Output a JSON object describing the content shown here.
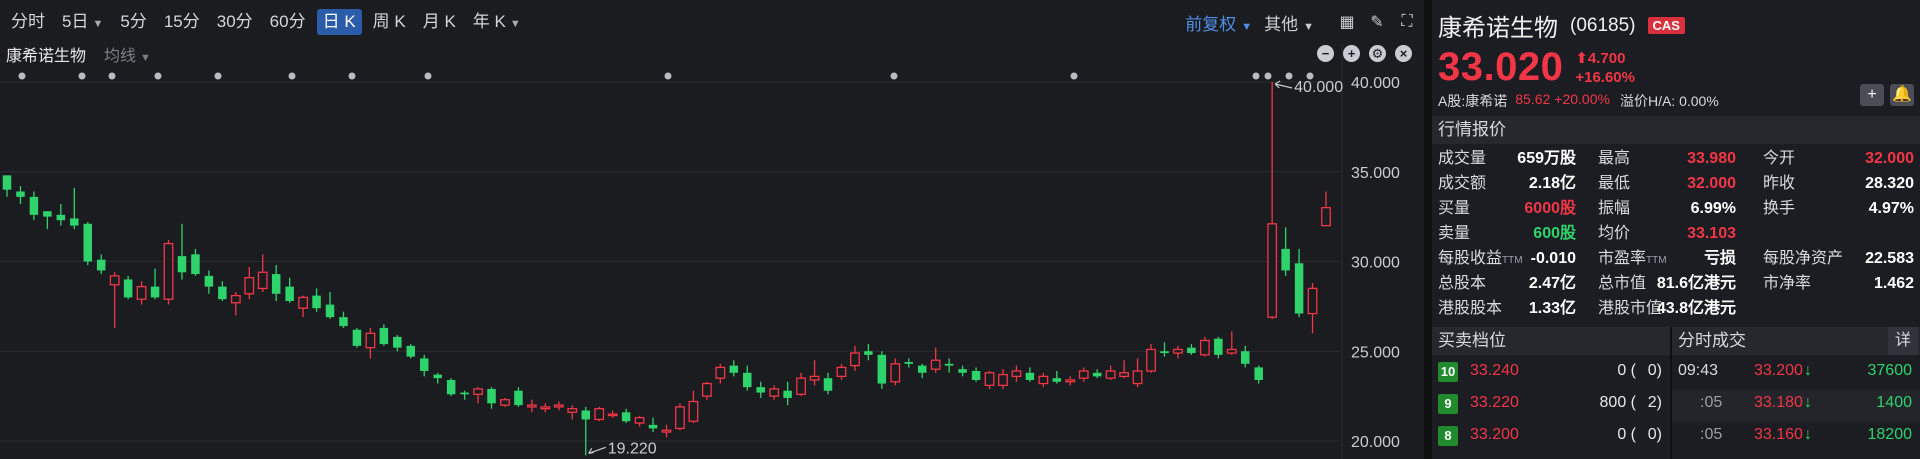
{
  "toolbar": {
    "periods": [
      "分时",
      "5日",
      "5分",
      "15分",
      "30分",
      "60分",
      "日 K",
      "周 K",
      "月 K",
      "年 K"
    ],
    "period_chevron": [
      "5日",
      "年 K"
    ],
    "active_period": "日 K",
    "restore_label": "前复权",
    "other_label": "其他"
  },
  "legend": {
    "name": "康希诺生物",
    "ma": "均线"
  },
  "chart_data": {
    "type": "candlestick",
    "yticks": [
      "40.000",
      "35.000",
      "30.000",
      "25.000",
      "20.000"
    ],
    "ytick_values": [
      40,
      35,
      30,
      25,
      20
    ],
    "annotation_high": "40.000",
    "annotation_low": "19.220",
    "colors": {
      "up": "#f23645",
      "down": "#2fd36b"
    },
    "candles": [
      [
        34.8,
        34.8,
        33.6,
        34.0
      ],
      [
        33.9,
        34.2,
        33.2,
        33.6
      ],
      [
        33.6,
        33.9,
        32.3,
        32.6
      ],
      [
        32.8,
        32.8,
        31.8,
        32.5
      ],
      [
        32.6,
        33.2,
        32.0,
        32.3
      ],
      [
        32.4,
        34.1,
        31.8,
        32.0
      ],
      [
        32.1,
        32.2,
        29.8,
        30.0
      ],
      [
        30.1,
        30.4,
        29.3,
        29.5
      ],
      [
        28.7,
        29.4,
        26.3,
        29.2
      ],
      [
        29.0,
        29.2,
        27.9,
        28.0
      ],
      [
        27.9,
        28.9,
        27.6,
        28.6
      ],
      [
        28.6,
        29.6,
        27.9,
        28.0
      ],
      [
        27.9,
        31.2,
        27.6,
        31.0
      ],
      [
        30.3,
        32.1,
        29.0,
        29.4
      ],
      [
        30.4,
        30.7,
        29.2,
        29.3
      ],
      [
        29.2,
        29.5,
        28.2,
        28.6
      ],
      [
        28.6,
        28.9,
        27.8,
        27.9
      ],
      [
        27.7,
        28.3,
        27.0,
        28.1
      ],
      [
        28.2,
        29.7,
        27.9,
        29.1
      ],
      [
        28.5,
        30.4,
        28.3,
        29.4
      ],
      [
        29.3,
        29.8,
        27.8,
        28.2
      ],
      [
        28.6,
        29.1,
        27.7,
        27.8
      ],
      [
        27.4,
        28.1,
        26.9,
        28.0
      ],
      [
        28.1,
        28.5,
        27.2,
        27.4
      ],
      [
        27.6,
        28.3,
        26.8,
        26.9
      ],
      [
        26.9,
        27.2,
        26.3,
        26.4
      ],
      [
        26.2,
        26.3,
        25.2,
        25.3
      ],
      [
        25.2,
        26.3,
        24.6,
        26.0
      ],
      [
        26.3,
        26.5,
        25.3,
        25.4
      ],
      [
        25.8,
        25.9,
        25.0,
        25.2
      ],
      [
        25.3,
        25.4,
        24.6,
        24.7
      ],
      [
        24.6,
        24.8,
        23.6,
        23.9
      ],
      [
        23.7,
        23.8,
        23.2,
        23.5
      ],
      [
        23.4,
        23.5,
        22.5,
        22.6
      ],
      [
        22.7,
        22.8,
        22.3,
        22.6
      ],
      [
        22.6,
        23.0,
        22.1,
        22.9
      ],
      [
        22.9,
        23.0,
        21.8,
        22.1
      ],
      [
        22.0,
        22.4,
        21.9,
        22.3
      ],
      [
        22.8,
        23.0,
        21.9,
        22.0
      ],
      [
        21.9,
        22.3,
        21.6,
        22.0
      ],
      [
        21.8,
        22.1,
        21.6,
        21.9
      ],
      [
        21.9,
        22.2,
        21.7,
        22.0
      ],
      [
        21.6,
        22.0,
        21.2,
        21.8
      ],
      [
        21.7,
        21.9,
        19.2,
        21.2
      ],
      [
        21.2,
        21.9,
        21.1,
        21.8
      ],
      [
        21.5,
        21.7,
        21.3,
        21.5
      ],
      [
        21.6,
        21.8,
        21.0,
        21.1
      ],
      [
        21.0,
        21.4,
        20.8,
        21.3
      ],
      [
        20.9,
        21.3,
        20.5,
        20.7
      ],
      [
        20.5,
        20.9,
        20.2,
        20.6
      ],
      [
        20.7,
        22.1,
        20.6,
        21.9
      ],
      [
        21.1,
        22.8,
        21.0,
        22.2
      ],
      [
        22.5,
        23.3,
        22.3,
        23.2
      ],
      [
        23.5,
        24.3,
        23.2,
        24.1
      ],
      [
        24.2,
        24.5,
        23.6,
        23.8
      ],
      [
        23.8,
        24.2,
        22.8,
        23.0
      ],
      [
        23.0,
        23.3,
        22.4,
        22.7
      ],
      [
        22.5,
        23.1,
        22.3,
        22.9
      ],
      [
        22.8,
        23.3,
        22.0,
        22.4
      ],
      [
        22.6,
        23.8,
        22.5,
        23.5
      ],
      [
        23.4,
        24.5,
        23.1,
        23.6
      ],
      [
        23.5,
        23.8,
        22.6,
        22.8
      ],
      [
        23.6,
        24.3,
        23.4,
        24.1
      ],
      [
        24.2,
        25.3,
        23.9,
        24.9
      ],
      [
        25.0,
        25.4,
        24.5,
        24.8
      ],
      [
        24.8,
        25.0,
        22.9,
        23.2
      ],
      [
        23.3,
        24.6,
        23.1,
        24.3
      ],
      [
        24.4,
        24.6,
        24.1,
        24.3
      ],
      [
        24.2,
        24.3,
        23.5,
        23.8
      ],
      [
        24.0,
        25.2,
        23.8,
        24.5
      ],
      [
        24.3,
        24.6,
        23.8,
        24.2
      ],
      [
        24.0,
        24.2,
        23.6,
        23.8
      ],
      [
        23.9,
        24.1,
        23.3,
        23.4
      ],
      [
        23.1,
        23.9,
        22.9,
        23.8
      ],
      [
        23.1,
        24.0,
        22.9,
        23.7
      ],
      [
        23.6,
        24.2,
        23.3,
        23.9
      ],
      [
        23.8,
        24.1,
        23.3,
        23.4
      ],
      [
        23.2,
        23.8,
        23.0,
        23.6
      ],
      [
        23.5,
        23.9,
        23.2,
        23.3
      ],
      [
        23.3,
        23.6,
        23.1,
        23.4
      ],
      [
        23.5,
        24.1,
        23.3,
        23.9
      ],
      [
        23.8,
        24.0,
        23.5,
        23.6
      ],
      [
        23.5,
        24.2,
        23.4,
        23.9
      ],
      [
        23.6,
        24.5,
        23.5,
        23.8
      ],
      [
        23.2,
        24.6,
        23.0,
        23.9
      ],
      [
        23.9,
        25.4,
        23.8,
        25.1
      ],
      [
        25.0,
        25.5,
        24.7,
        24.9
      ],
      [
        24.9,
        25.3,
        24.6,
        25.1
      ],
      [
        25.2,
        25.4,
        24.8,
        24.9
      ],
      [
        24.8,
        25.8,
        24.7,
        25.6
      ],
      [
        25.7,
        25.8,
        24.6,
        24.8
      ],
      [
        24.9,
        26.1,
        24.8,
        25.1
      ],
      [
        25.0,
        25.3,
        24.1,
        24.3
      ],
      [
        24.1,
        24.2,
        23.2,
        23.4
      ],
      [
        26.9,
        40.0,
        26.8,
        32.1
      ],
      [
        30.7,
        31.9,
        29.2,
        29.5
      ],
      [
        29.9,
        30.7,
        26.9,
        27.1
      ],
      [
        27.1,
        28.8,
        26.0,
        28.5
      ],
      [
        32.0,
        33.9,
        32.0,
        33.0
      ]
    ]
  },
  "stock": {
    "name": "康希诺生物",
    "code": "(06185)",
    "badge": "CAS",
    "price": "33.020",
    "change": "4.700",
    "change_arrow": "⬆",
    "change_pct": "+16.60%",
    "a_share_label": "A股:康希诺",
    "a_share_price": "85.62",
    "a_share_pct": "+20.00%",
    "premium": "溢价H/A: 0.00%"
  },
  "quote": {
    "title": "行情报价",
    "rows": [
      [
        [
          "成交量",
          "659万股",
          ""
        ],
        [
          "最高",
          "33.980",
          "red"
        ],
        [
          "今开",
          "32.000",
          "red"
        ]
      ],
      [
        [
          "成交额",
          "2.18亿",
          ""
        ],
        [
          "最低",
          "32.000",
          "red"
        ],
        [
          "昨收",
          "28.320",
          ""
        ]
      ],
      [
        [
          "买量",
          "6000股",
          "red"
        ],
        [
          "振幅",
          "6.99%",
          ""
        ],
        [
          "换手",
          "4.97%",
          ""
        ]
      ],
      [
        [
          "卖量",
          "600股",
          "green"
        ],
        [
          "均价",
          "33.103",
          "red"
        ],
        [
          "",
          "",
          ""
        ]
      ],
      [
        [
          "每股收益",
          "-0.010",
          ""
        ],
        [
          "市盈率",
          "亏损",
          ""
        ],
        [
          "每股净资产",
          "22.583",
          ""
        ]
      ],
      [
        [
          "总股本",
          "2.47亿",
          ""
        ],
        [
          "总市值",
          "81.6亿港元",
          ""
        ],
        [
          "市净率",
          "1.462",
          ""
        ]
      ],
      [
        [
          "港股股本",
          "1.33亿",
          ""
        ],
        [
          "港股市值",
          "43.8亿港元",
          ""
        ],
        [
          "",
          "",
          ""
        ]
      ]
    ],
    "ttm": "TTM"
  },
  "orderbook": {
    "title": "买卖档位",
    "rows": [
      {
        "level": "10",
        "price": "33.240",
        "vol": "0 (",
        "count": "0)"
      },
      {
        "level": "9",
        "price": "33.220",
        "vol": "800 (",
        "count": "2)"
      },
      {
        "level": "8",
        "price": "33.200",
        "vol": "0 (",
        "count": "0)"
      }
    ]
  },
  "trades": {
    "title": "分时成交",
    "detail": "详",
    "rows": [
      {
        "time": "09:43",
        "price": "33.200",
        "arrow": "🡣",
        "vol": "37600"
      },
      {
        "time": ":05",
        "price": "33.180",
        "arrow": "🡣",
        "vol": "1400"
      },
      {
        "time": ":05",
        "price": "33.160",
        "arrow": "🡣",
        "vol": "18200"
      }
    ]
  }
}
